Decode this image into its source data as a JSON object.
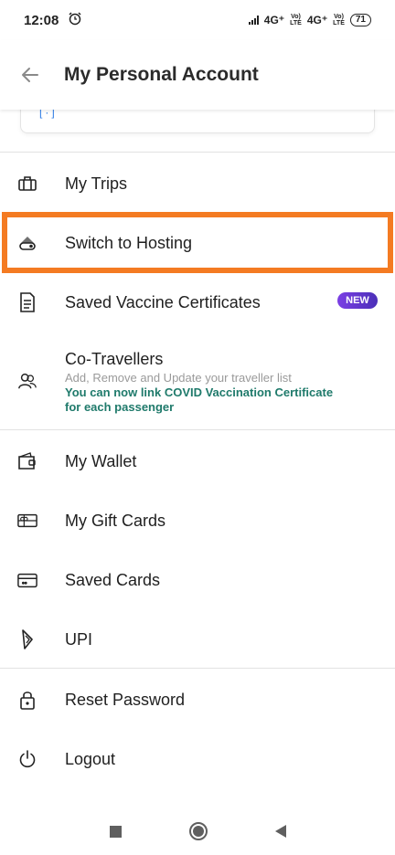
{
  "status": {
    "time": "12:08",
    "network1": "4G⁺",
    "volte1": "Vo)\nLTE",
    "network2": "4G⁺",
    "volte2": "Vo)\nLTE",
    "battery": "71"
  },
  "header": {
    "title": "My Personal Account"
  },
  "menu": {
    "trips": "My Trips",
    "hosting": "Switch to Hosting",
    "vaccine": "Saved Vaccine Certificates",
    "vaccine_badge": "NEW",
    "cotravellers_title": "Co-Travellers",
    "cotravellers_sub": "Add, Remove and Update your traveller list",
    "cotravellers_note": "You can now link COVID Vaccination Certificate for each passenger",
    "wallet": "My Wallet",
    "giftcards": "My Gift Cards",
    "savedcards": "Saved Cards",
    "upi": "UPI",
    "reset": "Reset Password",
    "logout": "Logout"
  },
  "colors": {
    "highlight": "#f47b22",
    "accent_teal": "#1f7a6b",
    "badge": "#6a37d6"
  },
  "icons": [
    "back-arrow-icon",
    "alarm-icon",
    "briefcase-icon",
    "hosting-icon",
    "document-icon",
    "people-icon",
    "wallet-icon",
    "gift-card-icon",
    "card-icon",
    "upi-icon",
    "lock-icon",
    "power-icon"
  ]
}
